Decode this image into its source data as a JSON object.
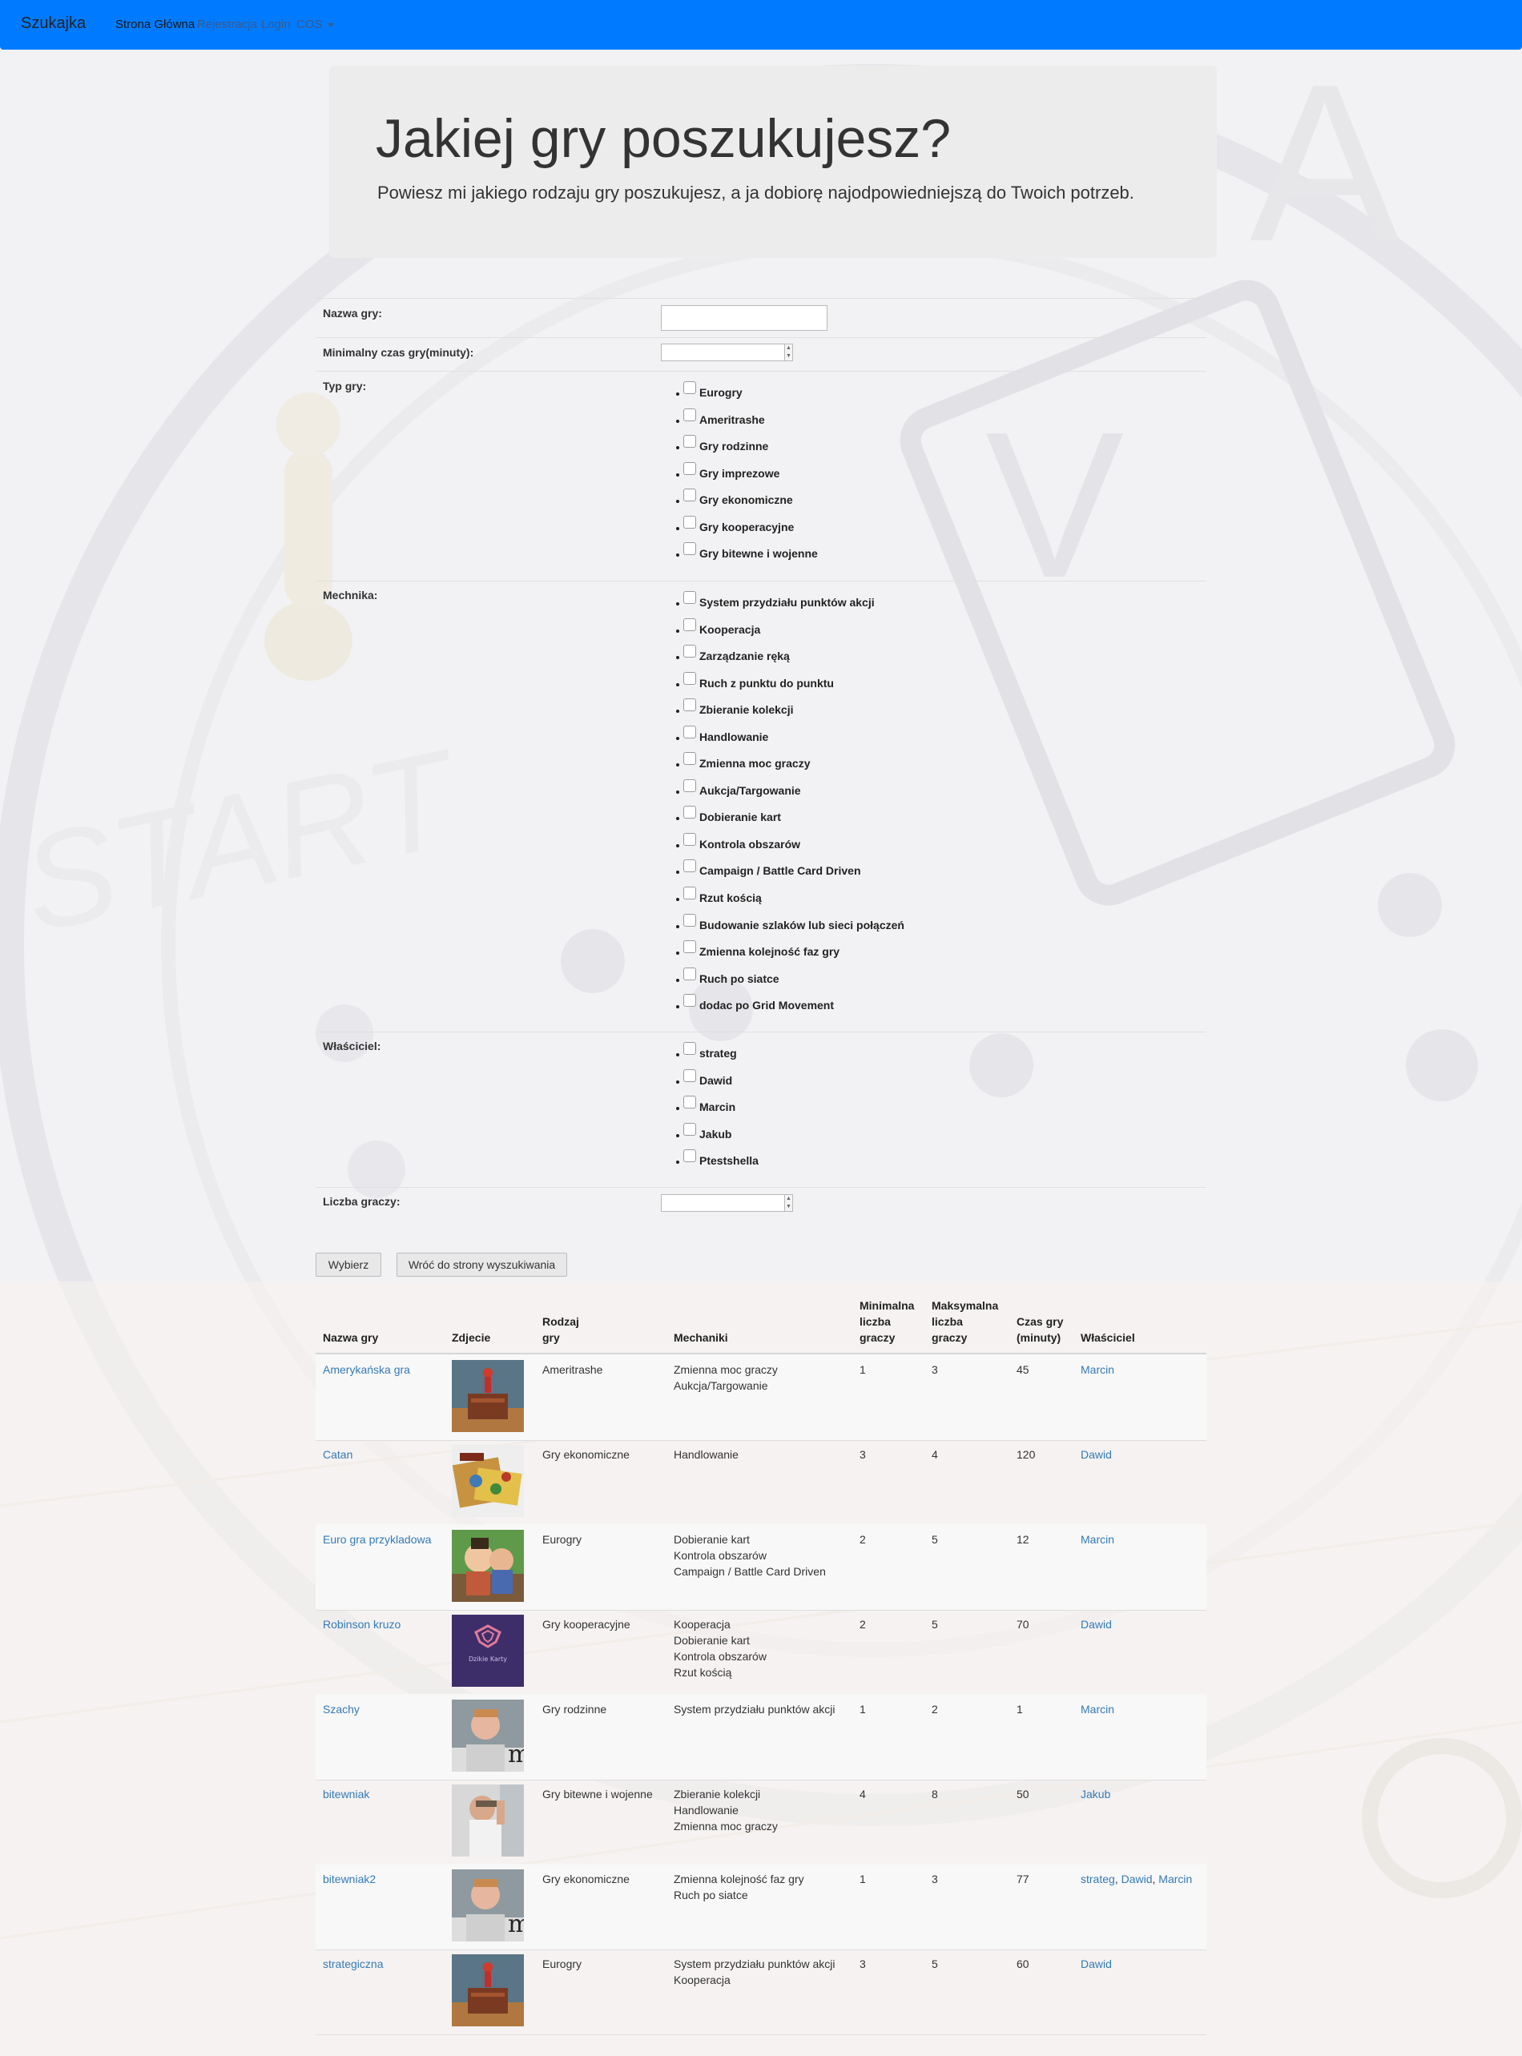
{
  "navbar": {
    "brand": "Szukajka",
    "links": [
      "Strona Główna",
      "Rejestracja",
      "Login",
      "COS"
    ]
  },
  "jumbotron": {
    "title": "Jakiej gry poszukujesz?",
    "lead": "Powiesz mi jakiego rodzaju gry poszukujesz, a ja dobiorę najodpowiedniejszą do Twoich potrzeb."
  },
  "form": {
    "name_label": "Nazwa gry:",
    "min_time_label": "Minimalny czas gry(minuty):",
    "type_label": "Typ gry:",
    "types": [
      "Eurogry",
      "Ameritrashe",
      "Gry rodzinne",
      "Gry imprezowe",
      "Gry ekonomiczne",
      "Gry kooperacyjne",
      "Gry bitewne i wojenne"
    ],
    "mechanics_label": "Mechnika:",
    "mechanics": [
      "System przydziału punktów akcji",
      "Kooperacja",
      "Zarządzanie ręką",
      "Ruch z punktu do punktu",
      "Zbieranie kolekcji",
      "Handlowanie",
      "Zmienna moc graczy",
      "Aukcja/Targowanie",
      "Dobieranie kart",
      "Kontrola obszarów",
      "Campaign / Battle Card Driven",
      "Rzut kością",
      "Budowanie szlaków lub sieci połączeń",
      "Zmienna kolejność faz gry",
      "Ruch po siatce",
      "dodac po Grid Movement"
    ],
    "owner_label": "Właściciel:",
    "owners": [
      "strateg",
      "Dawid",
      "Marcin",
      "Jakub",
      "Ptestshella"
    ],
    "players_label": "Liczba graczy:",
    "submit_label": "Wybierz",
    "back_label": "Wróć do strony wyszukiwania"
  },
  "table": {
    "headers": {
      "name": "Nazwa gry",
      "photo": "Zdjecie",
      "type": [
        "Rodzaj",
        "gry"
      ],
      "mechanics": "Mechaniki",
      "min_players": [
        "Minimalna",
        "liczba",
        "graczy"
      ],
      "max_players": [
        "Maksymalna",
        "liczba",
        "graczy"
      ],
      "time": [
        "Czas gry",
        "(minuty)"
      ],
      "owners": "Właściciel"
    },
    "rows": [
      {
        "name": "Amerykańska gra",
        "photo": "desk-figure",
        "type": "Ameritrashe",
        "mechanics": [
          "Zmienna moc graczy",
          "Aukcja/Targowanie"
        ],
        "min": "1",
        "max": "3",
        "time": "45",
        "owners": [
          "Marcin"
        ]
      },
      {
        "name": "Catan",
        "photo": "catan-box",
        "type": "Gry ekonomiczne",
        "mechanics": [
          "Handlowanie"
        ],
        "min": "3",
        "max": "4",
        "time": "120",
        "owners": [
          "Dawid"
        ]
      },
      {
        "name": "Euro gra przykladowa",
        "photo": "cartoon",
        "type": "Eurogry",
        "mechanics": [
          "Dobieranie kart",
          "Kontrola obszarów",
          "Campaign / Battle Card Driven"
        ],
        "min": "2",
        "max": "5",
        "time": "12",
        "owners": [
          "Marcin"
        ]
      },
      {
        "name": "Robinson kruzo",
        "photo": "logo-card",
        "type": "Gry kooperacyjne",
        "mechanics": [
          "Kooperacja",
          "Dobieranie kart",
          "Kontrola obszarów",
          "Rzut kością"
        ],
        "min": "2",
        "max": "5",
        "time": "70",
        "owners": [
          "Dawid"
        ]
      },
      {
        "name": "Szachy",
        "photo": "person",
        "type": "Gry rodzinne",
        "mechanics": [
          "System przydziału punktów akcji"
        ],
        "min": "1",
        "max": "2",
        "time": "1",
        "owners": [
          "Marcin"
        ]
      },
      {
        "name": "bitewniak",
        "photo": "person-hands",
        "type": "Gry bitewne i wojenne",
        "mechanics": [
          "Zbieranie kolekcji",
          "Handlowanie",
          "Zmienna moc graczy"
        ],
        "min": "4",
        "max": "8",
        "time": "50",
        "owners": [
          "Jakub"
        ]
      },
      {
        "name": "bitewniak2",
        "photo": "person",
        "type": "Gry ekonomiczne",
        "mechanics": [
          "Zmienna kolejność faz gry",
          "Ruch po siatce"
        ],
        "min": "1",
        "max": "3",
        "time": "77",
        "owners": [
          "strateg",
          "Dawid",
          "Marcin"
        ]
      },
      {
        "name": "strategiczna",
        "photo": "desk-figure",
        "type": "Eurogry",
        "mechanics": [
          "System przydziału punktów akcji",
          "Kooperacja"
        ],
        "min": "3",
        "max": "5",
        "time": "60",
        "owners": [
          "Dawid"
        ]
      }
    ]
  },
  "logo_text": "Dzikie Karty"
}
